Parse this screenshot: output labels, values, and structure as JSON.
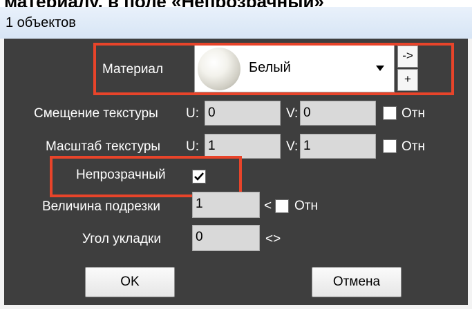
{
  "caption_fragment": "материалу, в поле «Непрозрачный»",
  "window": {
    "title": "1 объектов"
  },
  "material": {
    "label": "Материал",
    "value": "Белый",
    "arrow_button": "->",
    "add_button": "+"
  },
  "texture_offset": {
    "label": "Смещение текстуры",
    "u_label": "U:",
    "u_value": "0",
    "v_label": "V:",
    "v_value": "0",
    "relative_label": "Отн",
    "relative_checked": false
  },
  "texture_scale": {
    "label": "Масштаб текстуры",
    "u_label": "U:",
    "u_value": "1",
    "v_label": "V:",
    "v_value": "1",
    "relative_label": "Отн",
    "relative_checked": false
  },
  "opaque": {
    "label": "Непрозрачный",
    "checked": true
  },
  "trim": {
    "label": "Величина подрезки",
    "value": "1",
    "symbol": "<",
    "relative_label": "Отн",
    "relative_checked": false
  },
  "laying_angle": {
    "label": "Угол укладки",
    "value": "0",
    "symbol": "<>"
  },
  "buttons": {
    "ok": "OK",
    "cancel": "Отмена"
  },
  "colors": {
    "dialog_bg": "#3e3e3e",
    "highlight": "#e8442a"
  }
}
